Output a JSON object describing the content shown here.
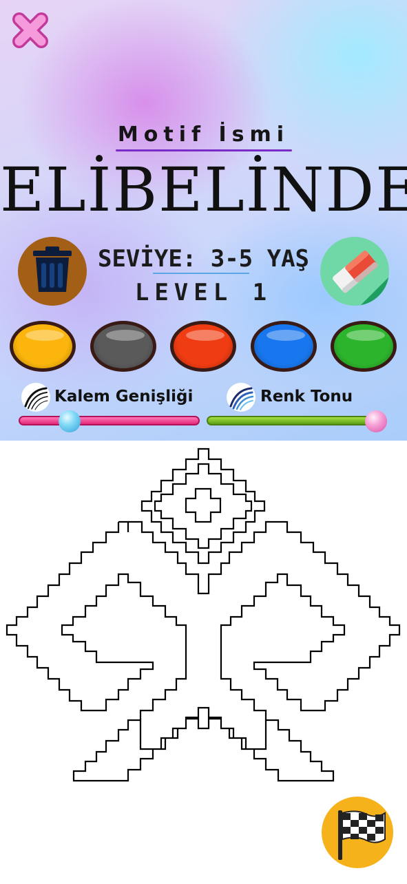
{
  "header": {
    "motif_label": "Motif İsmi",
    "motif_name": "ELİBELİNDE"
  },
  "level": {
    "age_text": "SEVİYE: 3-5 YAŞ",
    "level_text": "LEVEL 1"
  },
  "palette": [
    {
      "name": "yellow",
      "color": "#fbb50c"
    },
    {
      "name": "gray",
      "color": "#5a5a5a"
    },
    {
      "name": "red",
      "color": "#f03c12"
    },
    {
      "name": "blue",
      "color": "#1877ee"
    },
    {
      "name": "green",
      "color": "#2cb52c"
    }
  ],
  "sliders": {
    "pen_width_label": "Kalem Genişliği",
    "tone_label": "Renk Tonu",
    "pen_width_value": 0.25,
    "tone_value": 1.0
  },
  "icons": {
    "close": "close-icon",
    "trash": "trash-icon",
    "eraser": "eraser-icon",
    "pen_width": "brush-stroke-icon",
    "tone": "tone-waves-icon",
    "finish": "checkered-flag-icon"
  }
}
